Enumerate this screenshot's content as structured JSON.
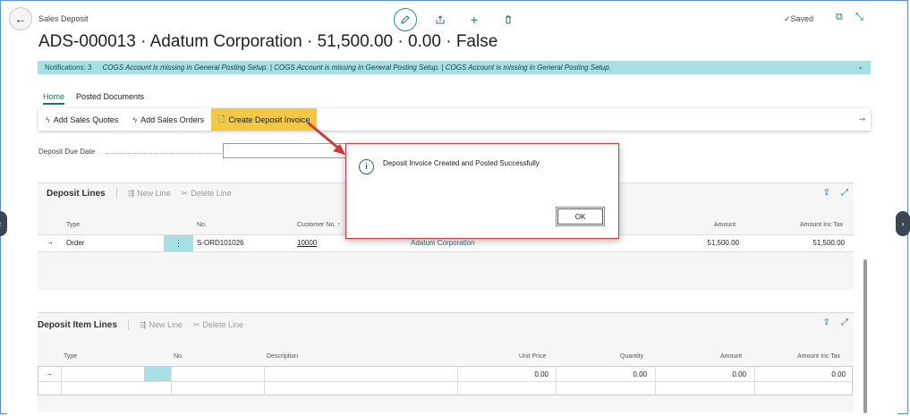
{
  "header": {
    "caption": "Sales Deposit",
    "saved": "Saved",
    "title": "ADS-000013 · Adatum Corporation · 51,500.00 · 0.00 · False"
  },
  "notifications": {
    "count": "Notifications: 3",
    "message": "COGS Account is missing in General Posting Setup.  |  COGS Account is missing in General Posting Setup.  |  COGS Account is missing in General Posting Setup."
  },
  "tabs": {
    "home": "Home",
    "posted": "Posted Documents"
  },
  "actions": {
    "add_quotes": "Add Sales Quotes",
    "add_orders": "Add Sales Orders",
    "create_invoice": "Create Deposit Invoice"
  },
  "fields": {
    "due_date_label": "Deposit Due Date"
  },
  "deposit_lines": {
    "title": "Deposit Lines",
    "new_line": "New Line",
    "delete_line": "Delete Line",
    "columns": {
      "type": "Type",
      "no": "No.",
      "customer_no": "Customer No. ↑",
      "amount": "Amount",
      "amount_inc_tax": "Amount Inc Tax"
    },
    "rows": [
      {
        "type": "Order",
        "no": "S-ORD101026",
        "customer_no": "10000",
        "customer_name": "Adatum Corporation",
        "amount": "51,500.00",
        "amount_inc_tax": "51,500.00"
      }
    ]
  },
  "item_lines": {
    "title": "Deposit Item Lines",
    "new_line": "New Line",
    "delete_line": "Delete Line",
    "columns": {
      "type": "Type",
      "no": "No.",
      "description": "Description",
      "unit_price": "Unit Price",
      "quantity": "Quantity",
      "amount": "Amount",
      "amount_inc_tax": "Amount Inc Tax"
    },
    "rows": [
      {
        "unit_price": "0.00",
        "quantity": "0.00",
        "amount": "0.00",
        "amount_inc_tax": "0.00"
      }
    ]
  },
  "dialog": {
    "message": "Deposit Invoice Created and Posted Successfully",
    "ok": "OK"
  },
  "colors": {
    "accent": "#1f6f7b",
    "notification_bg": "#a7dfe2",
    "highlight": "#f4c842",
    "callout": "#d23a3a"
  }
}
